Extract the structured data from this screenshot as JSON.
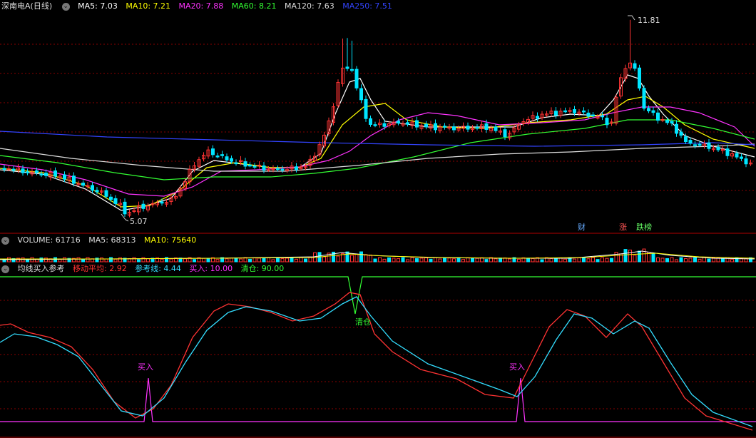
{
  "colors": {
    "up": "#ff3333",
    "down": "#00e5ff",
    "ma5": "#ffffff",
    "ma10": "#ffff00",
    "ma20": "#ff33ff",
    "ma60": "#33ff33",
    "ma120": "#dddddd",
    "ma250": "#3344ff",
    "grid": "#8a0000",
    "separator": "#b00000"
  },
  "main": {
    "title": "深南电A(日线)",
    "ma": [
      {
        "label": "MA5: 7.03",
        "color": "#ffffff"
      },
      {
        "label": "MA10: 7.21",
        "color": "#ffff00"
      },
      {
        "label": "MA20: 7.88",
        "color": "#ff33ff"
      },
      {
        "label": "MA60: 8.21",
        "color": "#33ff33"
      },
      {
        "label": "MA120: 7.63",
        "color": "#dddddd"
      },
      {
        "label": "MA250: 7.51",
        "color": "#3344ff"
      }
    ],
    "high_label": "11.81",
    "low_label": "5.07",
    "badges": [
      {
        "text": "财",
        "color": "#66aaff"
      },
      {
        "text": "涨",
        "color": "#ff5555"
      },
      {
        "text": "跌榜",
        "color": "#66ff66"
      }
    ]
  },
  "volume": {
    "title": "VOLUME: 61716",
    "ma5": "MA5: 68313",
    "ma10": "MA10: 75640"
  },
  "indicator": {
    "title": "均线买入参考",
    "items": [
      {
        "label": "移动平均: 2.92",
        "color": "#ff3333"
      },
      {
        "label": "参考线: 4.44",
        "color": "#33ddff"
      },
      {
        "label": "买入: 10.00",
        "color": "#ff33ff"
      },
      {
        "label": "清仓: 90.00",
        "color": "#33ff33"
      }
    ],
    "buy_label": "买入",
    "sell_label": "清仓"
  }
}
